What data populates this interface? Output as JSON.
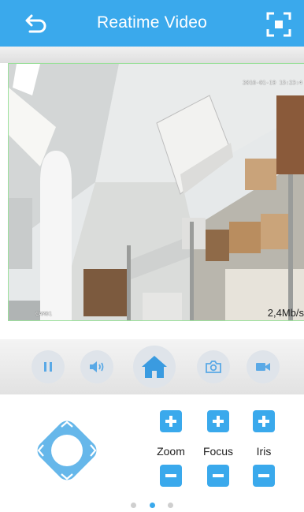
{
  "header": {
    "title": "Reatime Video",
    "back_icon": "back-arrow-icon",
    "fullscreen_icon": "fullscreen-icon"
  },
  "video": {
    "timestamp": "2016-01-19 15:23:4",
    "camera_label": "CAM01",
    "bitrate": "2,4Mb/s"
  },
  "controls": {
    "buttons": [
      "pause-icon",
      "volume-icon",
      "home-icon",
      "camera-icon",
      "video-record-icon"
    ]
  },
  "lens": {
    "zoom_label": "Zoom",
    "focus_label": "Focus",
    "iris_label": "Iris"
  },
  "pager": {
    "count": 3,
    "active": 1
  },
  "colors": {
    "accent": "#3aa9ec",
    "button_bg": "#dfe4ea",
    "icon": "#5aa9e6"
  }
}
